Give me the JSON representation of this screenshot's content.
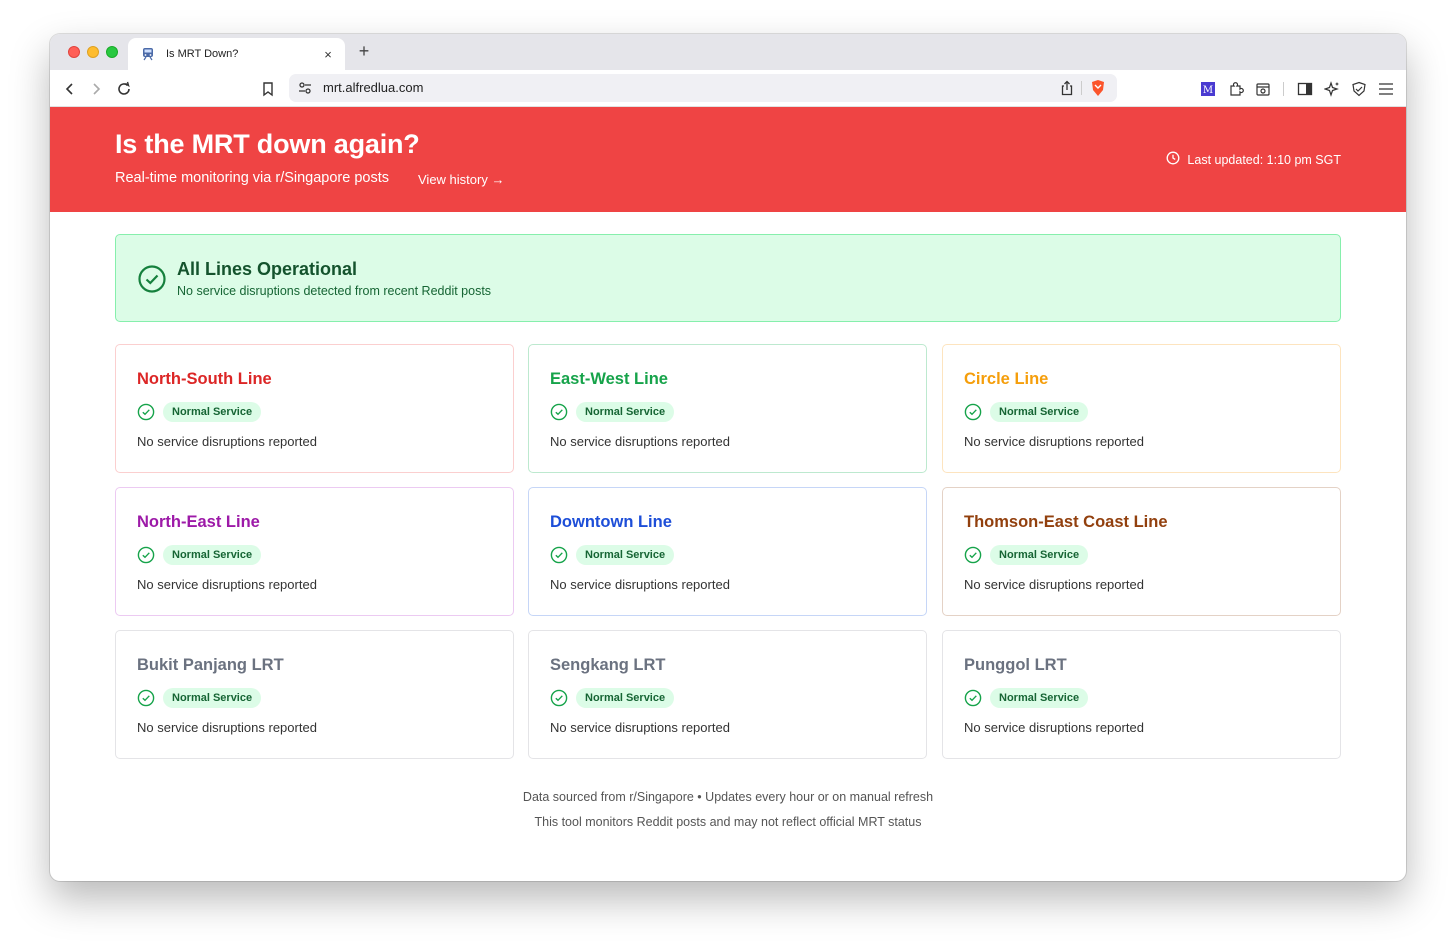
{
  "browser": {
    "tab_title": "Is MRT Down?",
    "tab_close": "×",
    "new_tab": "+",
    "url": "mrt.alfredlua.com"
  },
  "header": {
    "title": "Is the MRT down again?",
    "subtitle": "Real-time monitoring via r/Singapore posts",
    "history_link": "View history →",
    "last_updated": "Last updated: 1:10 pm SGT"
  },
  "status": {
    "title": "All Lines Operational",
    "subtitle": "No service disruptions detected from recent Reddit posts"
  },
  "lines": [
    {
      "name": "North-South Line",
      "color": "#dc2626",
      "border": "#fbcfcf",
      "badge": "Normal Service",
      "desc": "No service disruptions reported"
    },
    {
      "name": "East-West Line",
      "color": "#16a34a",
      "border": "#bde9cf",
      "badge": "Normal Service",
      "desc": "No service disruptions reported"
    },
    {
      "name": "Circle Line",
      "color": "#f59e0b",
      "border": "#fde4bf",
      "badge": "Normal Service",
      "desc": "No service disruptions reported"
    },
    {
      "name": "North-East Line",
      "color": "#9d1aa8",
      "border": "#eccaf2",
      "badge": "Normal Service",
      "desc": "No service disruptions reported"
    },
    {
      "name": "Downtown Line",
      "color": "#1d4ed8",
      "border": "#c6d6f7",
      "badge": "Normal Service",
      "desc": "No service disruptions reported"
    },
    {
      "name": "Thomson-East Coast Line",
      "color": "#92400e",
      "border": "#e4d2c6",
      "badge": "Normal Service",
      "desc": "No service disruptions reported"
    },
    {
      "name": "Bukit Panjang LRT",
      "color": "#6b7280",
      "border": "#e4e4e7",
      "badge": "Normal Service",
      "desc": "No service disruptions reported"
    },
    {
      "name": "Sengkang LRT",
      "color": "#6b7280",
      "border": "#e4e4e7",
      "badge": "Normal Service",
      "desc": "No service disruptions reported"
    },
    {
      "name": "Punggol LRT",
      "color": "#6b7280",
      "border": "#e4e4e7",
      "badge": "Normal Service",
      "desc": "No service disruptions reported"
    }
  ],
  "footer": {
    "line1": "Data sourced from r/Singapore • Updates every hour or on manual refresh",
    "line2": "This tool monitors Reddit posts and may not reflect official MRT status"
  },
  "colors": {
    "banner": "#ef4444",
    "status_bg": "#dcfce7",
    "status_border": "#86efac",
    "status_text": "#14532d",
    "check_green": "#16a34a"
  },
  "icons": [
    "train-icon",
    "back-icon",
    "forward-icon",
    "reload-icon",
    "bookmark-icon",
    "site-settings-icon",
    "share-icon",
    "brave-shield-icon",
    "extension-m-icon",
    "puzzle-icon",
    "screenshot-icon",
    "sidebar-icon",
    "leo-icon",
    "vpn-icon",
    "menu-icon",
    "clock-icon",
    "check-circle-icon"
  ]
}
